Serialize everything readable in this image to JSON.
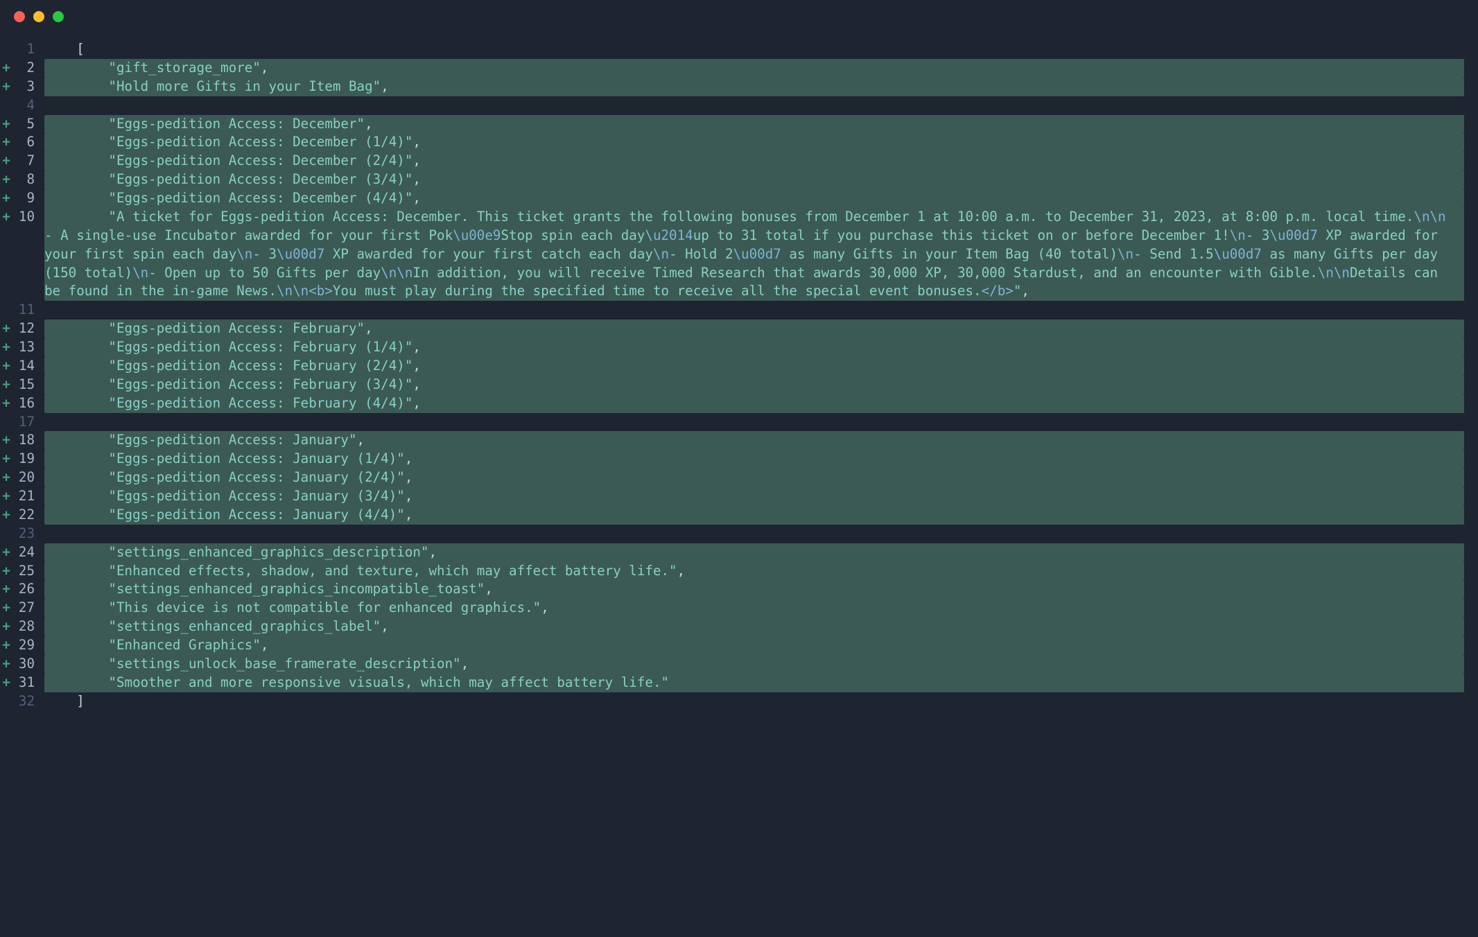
{
  "window": {
    "traffic_lights": [
      "close",
      "minimize",
      "zoom"
    ]
  },
  "diff": {
    "indent_base": "    ",
    "indent_item": "        ",
    "lines": [
      {
        "n": 1,
        "added": false,
        "kind": "open",
        "text": "["
      },
      {
        "n": 2,
        "added": true,
        "kind": "item",
        "text": "gift_storage_more"
      },
      {
        "n": 3,
        "added": true,
        "kind": "item",
        "text": "Hold more Gifts in your Item Bag"
      },
      {
        "n": 4,
        "added": false,
        "kind": "blank"
      },
      {
        "n": 5,
        "added": true,
        "kind": "item",
        "text": "Eggs-pedition Access: December"
      },
      {
        "n": 6,
        "added": true,
        "kind": "item",
        "text": "Eggs-pedition Access: December (1/4)"
      },
      {
        "n": 7,
        "added": true,
        "kind": "item",
        "text": "Eggs-pedition Access: December (2/4)"
      },
      {
        "n": 8,
        "added": true,
        "kind": "item",
        "text": "Eggs-pedition Access: December (3/4)"
      },
      {
        "n": 9,
        "added": true,
        "kind": "item",
        "text": "Eggs-pedition Access: December (4/4)"
      },
      {
        "n": 10,
        "added": true,
        "kind": "item_rich",
        "segments": [
          {
            "t": "txt",
            "v": "A ticket for Eggs-pedition Access: December. This ticket grants the following bonuses from December 1 at 10:00 a.m. to December 31, 2023, at 8:00 p.m. local time."
          },
          {
            "t": "esc",
            "v": "\\n\\n"
          },
          {
            "t": "txt",
            "v": "- A single-use Incubator awarded for your first Pok"
          },
          {
            "t": "esc",
            "v": "\\u00e9"
          },
          {
            "t": "txt",
            "v": "Stop spin each day"
          },
          {
            "t": "esc",
            "v": "\\u2014"
          },
          {
            "t": "txt",
            "v": "up to 31 total if you purchase this ticket on or before December 1!"
          },
          {
            "t": "esc",
            "v": "\\n"
          },
          {
            "t": "txt",
            "v": "- 3"
          },
          {
            "t": "esc",
            "v": "\\u00d7"
          },
          {
            "t": "txt",
            "v": " XP awarded for your first spin each day"
          },
          {
            "t": "esc",
            "v": "\\n"
          },
          {
            "t": "txt",
            "v": "- 3"
          },
          {
            "t": "esc",
            "v": "\\u00d7"
          },
          {
            "t": "txt",
            "v": " XP awarded for your first catch each day"
          },
          {
            "t": "esc",
            "v": "\\n"
          },
          {
            "t": "txt",
            "v": "- Hold 2"
          },
          {
            "t": "esc",
            "v": "\\u00d7"
          },
          {
            "t": "txt",
            "v": " as many Gifts in your Item Bag (40 total)"
          },
          {
            "t": "esc",
            "v": "\\n"
          },
          {
            "t": "txt",
            "v": "- Send 1.5"
          },
          {
            "t": "esc",
            "v": "\\u00d7"
          },
          {
            "t": "txt",
            "v": " as many Gifts per day (150 total)"
          },
          {
            "t": "esc",
            "v": "\\n"
          },
          {
            "t": "txt",
            "v": "- Open up to 50 Gifts per day"
          },
          {
            "t": "esc",
            "v": "\\n\\n"
          },
          {
            "t": "txt",
            "v": "In addition, you will receive Timed Research that awards 30,000 XP, 30,000 Stardust, and an encounter with Gible."
          },
          {
            "t": "esc",
            "v": "\\n\\n"
          },
          {
            "t": "txt",
            "v": "Details can be found in the in-game News."
          },
          {
            "t": "esc",
            "v": "\\n\\n"
          },
          {
            "t": "tag",
            "v": "<b>"
          },
          {
            "t": "txt",
            "v": "You must play during the specified time to receive all the special event bonuses."
          },
          {
            "t": "tag",
            "v": "</b>"
          }
        ]
      },
      {
        "n": 11,
        "added": false,
        "kind": "blank"
      },
      {
        "n": 12,
        "added": true,
        "kind": "item",
        "text": "Eggs-pedition Access: February"
      },
      {
        "n": 13,
        "added": true,
        "kind": "item",
        "text": "Eggs-pedition Access: February (1/4)"
      },
      {
        "n": 14,
        "added": true,
        "kind": "item",
        "text": "Eggs-pedition Access: February (2/4)"
      },
      {
        "n": 15,
        "added": true,
        "kind": "item",
        "text": "Eggs-pedition Access: February (3/4)"
      },
      {
        "n": 16,
        "added": true,
        "kind": "item",
        "text": "Eggs-pedition Access: February (4/4)"
      },
      {
        "n": 17,
        "added": false,
        "kind": "blank"
      },
      {
        "n": 18,
        "added": true,
        "kind": "item",
        "text": "Eggs-pedition Access: January"
      },
      {
        "n": 19,
        "added": true,
        "kind": "item",
        "text": "Eggs-pedition Access: January (1/4)"
      },
      {
        "n": 20,
        "added": true,
        "kind": "item",
        "text": "Eggs-pedition Access: January (2/4)"
      },
      {
        "n": 21,
        "added": true,
        "kind": "item",
        "text": "Eggs-pedition Access: January (3/4)"
      },
      {
        "n": 22,
        "added": true,
        "kind": "item",
        "text": "Eggs-pedition Access: January (4/4)"
      },
      {
        "n": 23,
        "added": false,
        "kind": "blank"
      },
      {
        "n": 24,
        "added": true,
        "kind": "item",
        "text": "settings_enhanced_graphics_description"
      },
      {
        "n": 25,
        "added": true,
        "kind": "item",
        "text": "Enhanced effects, shadow, and texture, which may affect battery life."
      },
      {
        "n": 26,
        "added": true,
        "kind": "item",
        "text": "settings_enhanced_graphics_incompatible_toast"
      },
      {
        "n": 27,
        "added": true,
        "kind": "item",
        "text": "This device is not compatible for enhanced graphics."
      },
      {
        "n": 28,
        "added": true,
        "kind": "item",
        "text": "settings_enhanced_graphics_label"
      },
      {
        "n": 29,
        "added": true,
        "kind": "item",
        "text": "Enhanced Graphics"
      },
      {
        "n": 30,
        "added": true,
        "kind": "item",
        "text": "settings_unlock_base_framerate_description"
      },
      {
        "n": 31,
        "added": true,
        "kind": "item_last",
        "text": "Smoother and more responsive visuals, which may affect battery life."
      },
      {
        "n": 32,
        "added": false,
        "kind": "close",
        "text": "]"
      }
    ]
  }
}
